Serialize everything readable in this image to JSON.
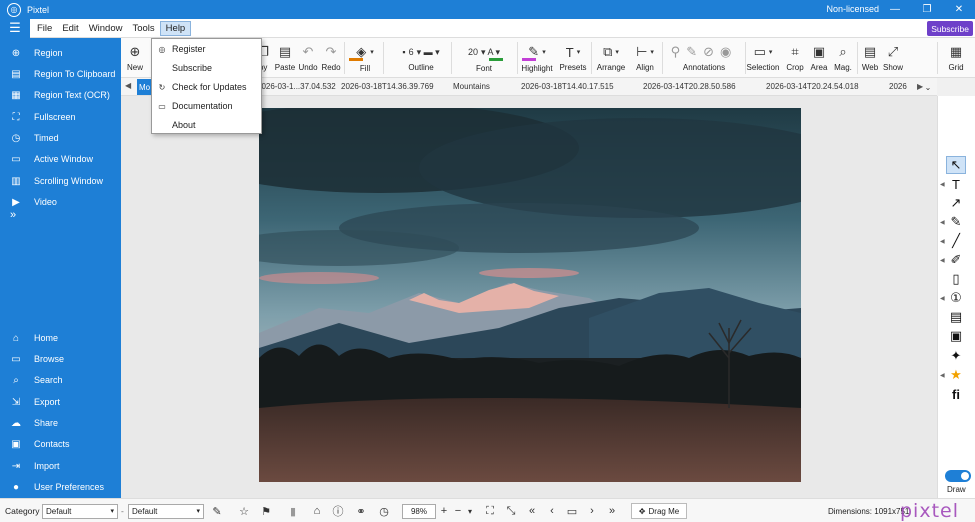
{
  "window": {
    "title": "Pixtel",
    "license": "Non-licensed",
    "minimize": "—",
    "restore": "❐",
    "close": "✕"
  },
  "menu": {
    "items": [
      "File",
      "Edit",
      "Window",
      "Tools",
      "Help"
    ],
    "subscribe": "Subscribe"
  },
  "help_menu": {
    "items": [
      {
        "label": "Register",
        "icon": "register-icon"
      },
      {
        "label": "Subscribe",
        "icon": "subscribe-icon"
      },
      {
        "label": "Check for Updates",
        "icon": "updates-icon"
      },
      {
        "label": "Documentation",
        "icon": "documentation-icon"
      },
      {
        "label": "About",
        "icon": ""
      }
    ]
  },
  "sidebar": {
    "top_items": [
      {
        "label": "Region",
        "icon": "region-icon"
      },
      {
        "label": "Region To Clipboard",
        "icon": "clipboard-icon"
      },
      {
        "label": "Region Text (OCR)",
        "icon": "ocr-icon"
      },
      {
        "label": "Fullscreen",
        "icon": "fullscreen-icon"
      },
      {
        "label": "Timed",
        "icon": "timed-icon"
      },
      {
        "label": "Active Window",
        "icon": "window-icon"
      },
      {
        "label": "Scrolling Window",
        "icon": "scroll-icon"
      },
      {
        "label": "Video",
        "icon": "video-icon"
      }
    ],
    "more": "»",
    "bottom_items": [
      {
        "label": "Home",
        "icon": "home-icon"
      },
      {
        "label": "Browse",
        "icon": "browse-icon"
      },
      {
        "label": "Search",
        "icon": "search-icon"
      },
      {
        "label": "Export",
        "icon": "export-icon"
      },
      {
        "label": "Share",
        "icon": "share-icon"
      },
      {
        "label": "Contacts",
        "icon": "contacts-icon"
      },
      {
        "label": "Import",
        "icon": "import-icon"
      },
      {
        "label": "User Preferences",
        "icon": "user-icon"
      }
    ]
  },
  "ribbon": {
    "new": "New",
    "copy": "Copy",
    "paste": "Paste",
    "undo": "Undo",
    "redo": "Redo",
    "fill": "Fill",
    "outline": "Outline",
    "outline_width": "6",
    "font": "Font",
    "font_size": "20",
    "highlight": "Highlight",
    "presets": "Presets",
    "arrange": "Arrange",
    "align": "Align",
    "annotations": "Annotations",
    "selection": "Selection",
    "crop": "Crop",
    "area": "Area",
    "mag": "Mag.",
    "web": "Web",
    "show": "Show",
    "grid": "Grid"
  },
  "filmstrip": {
    "active": "Mo",
    "items": [
      "2026-03-1...37.04.532",
      "2026-03-18T14.36.39.769",
      "Mountains",
      "2026-03-18T14.40.17.515",
      "2026-03-14T20.28.50.586",
      "2026-03-14T20.24.54.018",
      "2026"
    ]
  },
  "right_tools": {
    "draw": "Draw"
  },
  "status": {
    "category_label": "Category",
    "category_value": "Default",
    "second_value": "Default",
    "zoom": "98%",
    "drag_me": "Drag Me",
    "dimensions": "Dimensions: 1091x751",
    "logo": "pixtel"
  },
  "colors": {
    "accent": "#1e7fd6",
    "subscribe": "#6e40c9",
    "fill_swatch": "#e07b00",
    "font_swatch": "#2a9d3a",
    "highlight_swatch": "#c23fd6"
  }
}
